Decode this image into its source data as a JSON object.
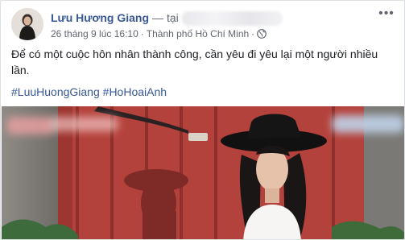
{
  "post": {
    "author": "Lưu Hương Giang",
    "arrow": "—",
    "at_text": "tại",
    "timestamp": "26 tháng 9 lúc 16:10",
    "separator": "·",
    "location": "Thành phố Hồ Chí Minh",
    "audience_icon": "globe-icon",
    "more_icon": "more-options-icon",
    "text": "Để có một cuộc hôn nhân thành công, cần yêu đi yêu lại một người nhiều lần.",
    "hashtags": [
      "#LuuHuongGiang",
      "#HoHoaiAnh"
    ]
  },
  "colors": {
    "link": "#385898",
    "text": "#1c1e21",
    "secondary": "#616770",
    "door_red": "#b5473f"
  }
}
